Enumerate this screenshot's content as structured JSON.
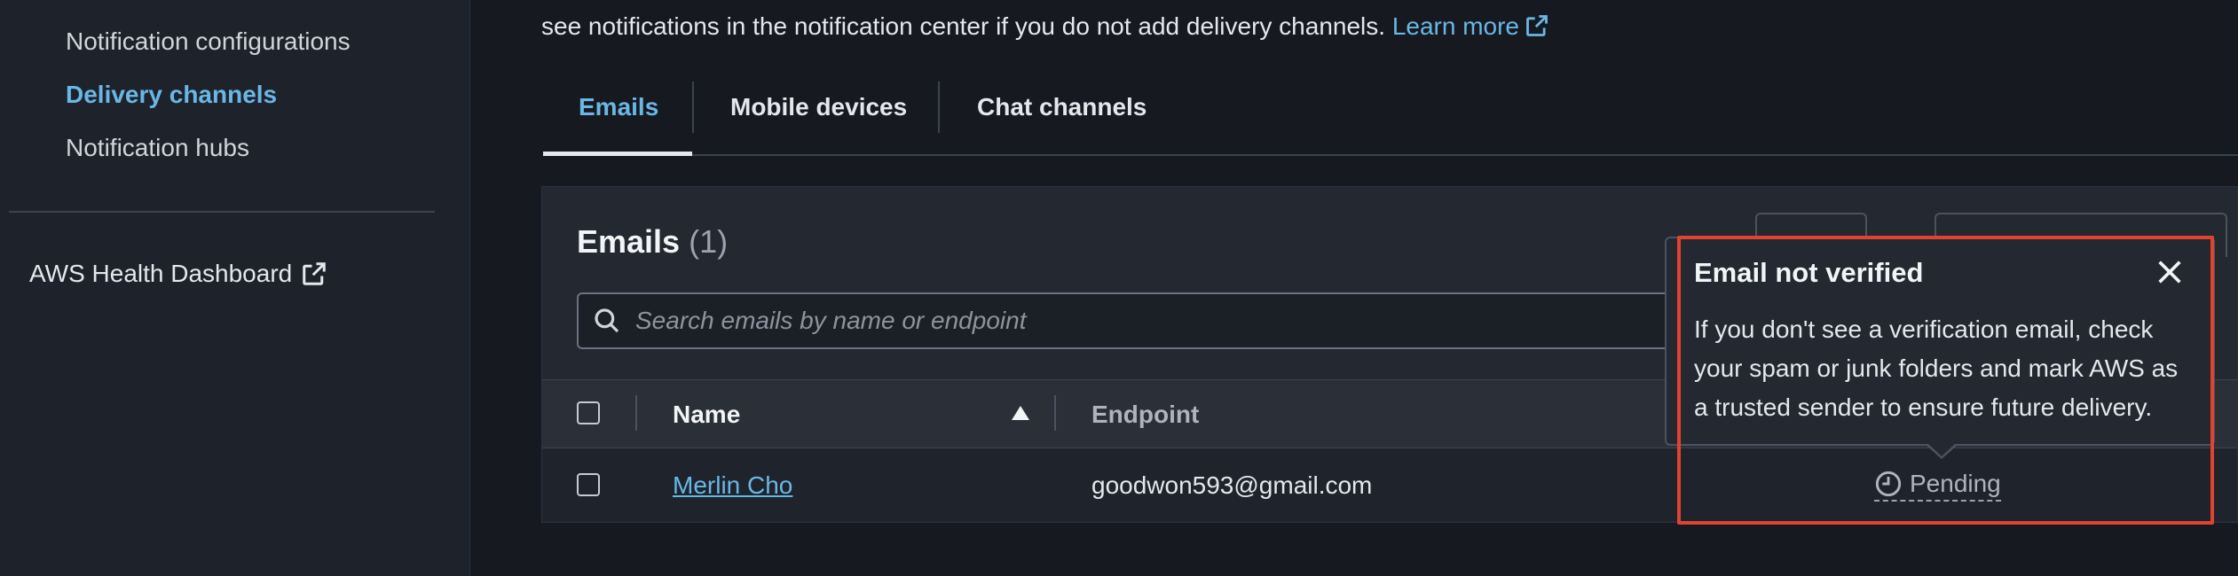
{
  "sidebar": {
    "items": [
      {
        "label": "Notification configurations"
      },
      {
        "label": "Delivery channels"
      },
      {
        "label": "Notification hubs"
      }
    ],
    "external_link": "AWS Health Dashboard"
  },
  "intro": {
    "text": "see notifications in the notification center if you do not add delivery channels.",
    "learn_more": "Learn more"
  },
  "tabs": [
    {
      "label": "Emails"
    },
    {
      "label": "Mobile devices"
    },
    {
      "label": "Chat channels"
    }
  ],
  "panel": {
    "title": "Emails",
    "count": "(1)",
    "search_placeholder": "Search emails by name or endpoint"
  },
  "table": {
    "columns": [
      "Name",
      "Endpoint"
    ],
    "rows": [
      {
        "name": "Merlin Cho",
        "endpoint": "goodwon593@gmail.com",
        "status": "Pending"
      }
    ]
  },
  "popover": {
    "title": "Email not verified",
    "body": "If you don't see a verification email, check your spam or junk folders and mark AWS as a trusted sender to ensure future delivery."
  },
  "colors": {
    "accent": "#6ab7e5",
    "highlight": "#e0432f",
    "background": "#16191f"
  }
}
